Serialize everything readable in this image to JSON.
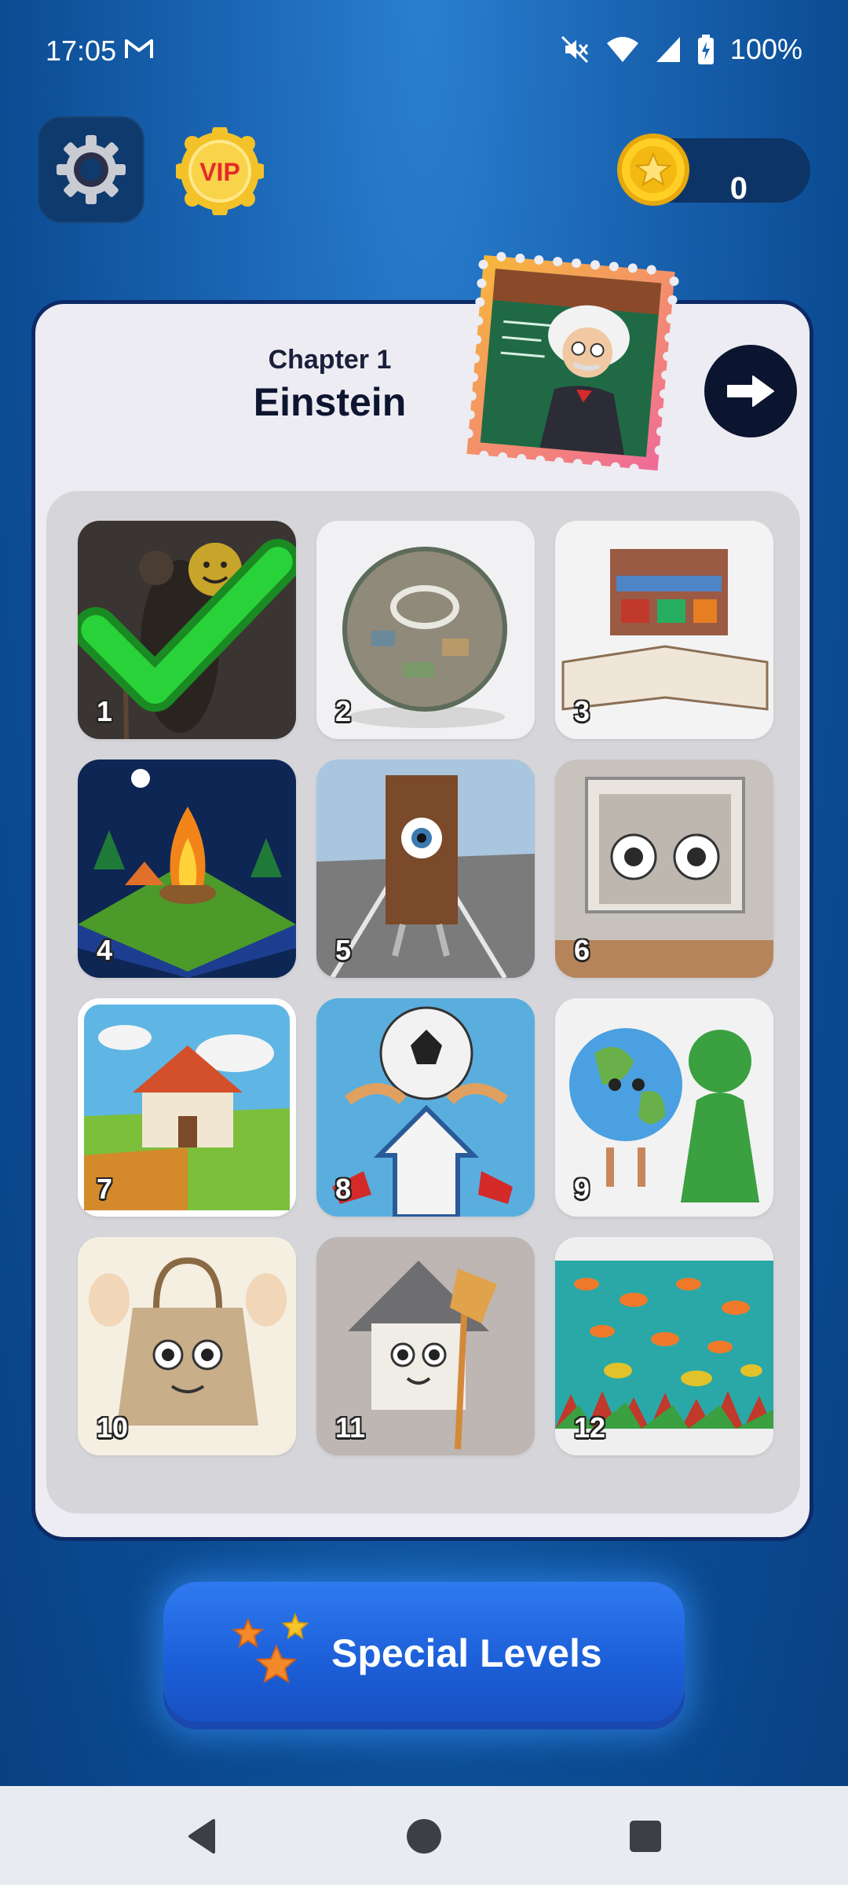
{
  "status_bar": {
    "time": "17:05",
    "battery": "100%"
  },
  "header": {
    "coins": "0",
    "vip_label": "VIP"
  },
  "chapter": {
    "subtitle": "Chapter 1",
    "title": "Einstein"
  },
  "levels": [
    {
      "number": "1",
      "completed": true,
      "image": "old man with smiley backpack"
    },
    {
      "number": "2",
      "completed": false,
      "image": "miniature city planet"
    },
    {
      "number": "3",
      "completed": false,
      "image": "market stall on open book"
    },
    {
      "number": "4",
      "completed": false,
      "image": "campfire in night forest"
    },
    {
      "number": "5",
      "completed": false,
      "image": "door with eye on road"
    },
    {
      "number": "6",
      "completed": false,
      "image": "window with eyes"
    },
    {
      "number": "7",
      "completed": false,
      "image": "farm house in fields"
    },
    {
      "number": "8",
      "completed": false,
      "image": "soccer ball with legs and arrow"
    },
    {
      "number": "9",
      "completed": false,
      "image": "earth and green lady"
    },
    {
      "number": "10",
      "completed": false,
      "image": "shopping bag character"
    },
    {
      "number": "11",
      "completed": false,
      "image": "house character with broom"
    },
    {
      "number": "12",
      "completed": false,
      "image": "colorful fish school"
    }
  ],
  "special_button": {
    "label": "Special Levels"
  },
  "colors": {
    "accent": "#1c5fd8",
    "card": "#ececf2",
    "check": "#20c030"
  }
}
